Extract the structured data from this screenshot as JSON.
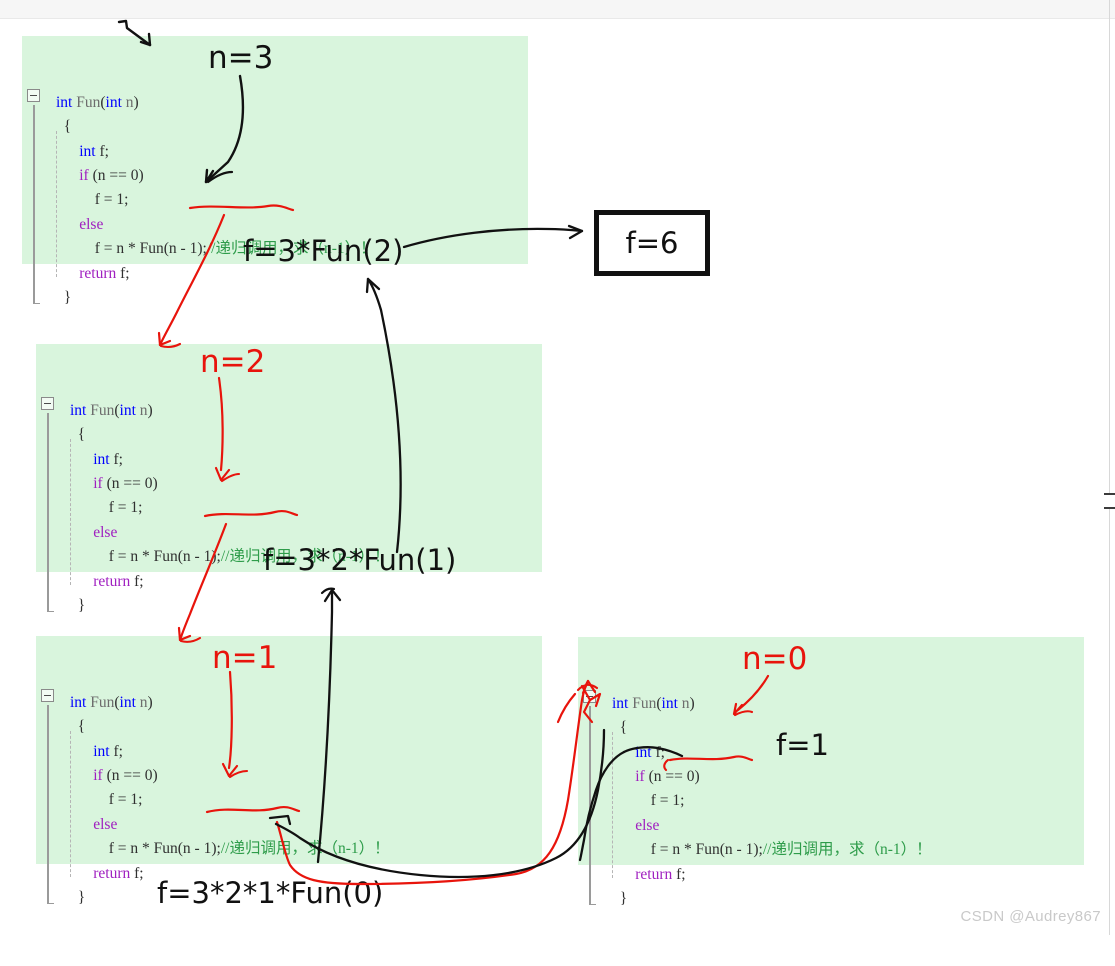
{
  "watermark": "CSDN @Audrey867",
  "code": {
    "signature_pre": "int ",
    "lines": [
      {
        "id": "sig",
        "segs": [
          [
            "kw",
            "int"
          ],
          [
            "pl",
            " "
          ],
          [
            "fn",
            "Fun"
          ],
          [
            "br",
            "("
          ],
          [
            "kw",
            "int"
          ],
          [
            "pl",
            " "
          ],
          [
            "fn",
            "n"
          ],
          [
            "br",
            ")"
          ]
        ]
      },
      {
        "id": "open",
        "segs": [
          [
            "br",
            "  {"
          ]
        ]
      },
      {
        "id": "decl",
        "segs": [
          [
            "pl",
            "      "
          ],
          [
            "kw",
            "int"
          ],
          [
            "pl",
            " f;"
          ]
        ]
      },
      {
        "id": "if",
        "segs": [
          [
            "pl",
            "      "
          ],
          [
            "ctl",
            "if"
          ],
          [
            "pl",
            " (n == 0)"
          ]
        ]
      },
      {
        "id": "assign",
        "segs": [
          [
            "pl",
            "          f = 1;"
          ]
        ]
      },
      {
        "id": "else",
        "segs": [
          [
            "pl",
            "      "
          ],
          [
            "ctl",
            "else"
          ]
        ]
      },
      {
        "id": "rec",
        "segs": [
          [
            "pl",
            "          f = n * Fun(n - 1);"
          ],
          [
            "cm",
            "//递归调用，求（n-1）！"
          ]
        ]
      },
      {
        "id": "ret",
        "segs": [
          [
            "pl",
            "      "
          ],
          [
            "ctl",
            "return"
          ],
          [
            "pl",
            " f;"
          ]
        ]
      },
      {
        "id": "close",
        "segs": [
          [
            "br",
            "  }"
          ]
        ]
      }
    ]
  },
  "blocks": [
    {
      "name": "block-n3",
      "n_label": "n=3",
      "n_color": "#111111"
    },
    {
      "name": "block-n2",
      "n_label": "n=2",
      "n_color": "#e8140c"
    },
    {
      "name": "block-n1",
      "n_label": "n=1",
      "n_color": "#e8140c"
    },
    {
      "name": "block-n0",
      "n_label": "n=0",
      "n_color": "#e8140c"
    }
  ],
  "annotations": {
    "f3": "f=3*Fun(2)",
    "f32": "f=3*2*Fun(1)",
    "f321": "f=3*2*1*Fun(0)",
    "f_one": "f=1",
    "f_six": "f=6"
  },
  "colors": {
    "block_bg": "#d9f5dd",
    "keyword": "#0000ff",
    "control": "#a020c0",
    "comment": "#2e9c4a",
    "red_ink": "#e8140c",
    "black_ink": "#111111"
  }
}
